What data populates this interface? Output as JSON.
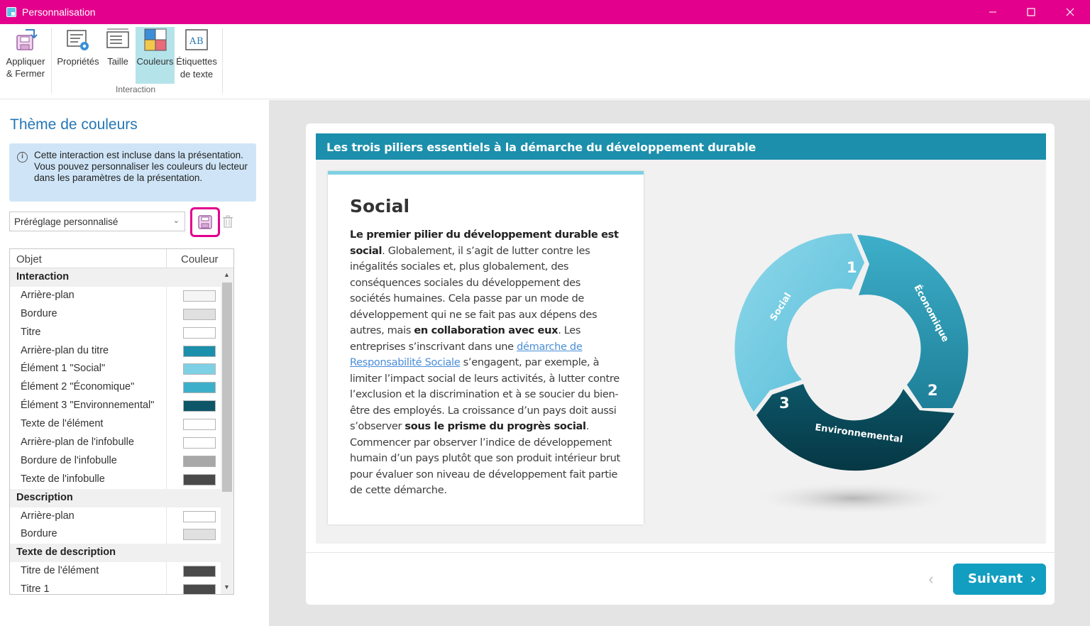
{
  "window": {
    "title": "Personnalisation",
    "controls": [
      "minimize",
      "maximize",
      "close"
    ]
  },
  "ribbon": {
    "apply_close_line1": "Appliquer",
    "apply_close_line2": "& Fermer",
    "buttons": [
      {
        "label": "Propriétés"
      },
      {
        "label": "Taille"
      },
      {
        "label": "Couleurs",
        "active": true
      },
      {
        "label_line1": "Étiquettes",
        "label_line2": "de texte"
      }
    ],
    "group_label": "Interaction"
  },
  "left_panel": {
    "title": "Thème de couleurs",
    "info_text": "Cette interaction est incluse dans la présentation. Vous pouvez personnaliser les couleurs du lecteur dans les paramètres de la présentation.",
    "preset_value": "Préréglage personnalisé",
    "table_headers": {
      "object": "Objet",
      "color": "Couleur"
    },
    "rows": [
      {
        "type": "group",
        "label": "Interaction"
      },
      {
        "type": "item",
        "label": "Arrière-plan",
        "color": "#f5f5f5"
      },
      {
        "type": "item",
        "label": "Bordure",
        "color": "#e0e0e0"
      },
      {
        "type": "item",
        "label": "Titre",
        "color": "#ffffff"
      },
      {
        "type": "item",
        "label": "Arrière-plan du titre",
        "color": "#1b8fab"
      },
      {
        "type": "item",
        "label": "Élément 1 \"Social\"",
        "color": "#7ed0e4"
      },
      {
        "type": "item",
        "label": "Élément 2 \"Économique\"",
        "color": "#3eafca"
      },
      {
        "type": "item",
        "label": "Élément 3 \"Environnemental\"",
        "color": "#0c5668"
      },
      {
        "type": "item",
        "label": "Texte de l'élément",
        "color": "#ffffff"
      },
      {
        "type": "item",
        "label": "Arrière-plan de l'infobulle",
        "color": "#ffffff"
      },
      {
        "type": "item",
        "label": "Bordure de l'infobulle",
        "color": "#a8a8a8"
      },
      {
        "type": "item",
        "label": "Texte de l'infobulle",
        "color": "#4a4a4a"
      },
      {
        "type": "group",
        "label": "Description"
      },
      {
        "type": "item",
        "label": "Arrière-plan",
        "color": "#ffffff"
      },
      {
        "type": "item",
        "label": "Bordure",
        "color": "#e0e0e0"
      },
      {
        "type": "group",
        "label": "Texte de description"
      },
      {
        "type": "item",
        "label": "Titre de l'élément",
        "color": "#4a4a4a"
      },
      {
        "type": "item",
        "label": "Titre 1",
        "color": "#4a4a4a"
      }
    ]
  },
  "slide": {
    "header": "Les trois piliers essentiels à la démarche du développement durable",
    "panel_title": "Social",
    "body": {
      "b1": "Le premier pilier du développement durable est social",
      "t1": ". Globalement, il s’agit de lutter contre les inégalités sociales et, plus globalement, des conséquences sociales du développement des sociétés humaines. Cela passe par un mode de développement qui ne se fait pas aux dépens des autres, mais ",
      "b2": "en collaboration avec eux",
      "t2": ". Les entreprises s’inscrivant dans une ",
      "link": "démarche de Responsabilité Sociale",
      "t3": " s’engagent, par exemple, à limiter l’impact social de leurs activités, à lutter contre l’exclusion et la discrimination et à se soucier du bien-être des employés. La croissance d’un pays doit aussi s’observer ",
      "b3": "sous le prisme du progrès social",
      "t4": ". Commencer par observer l’indice de développement humain d’un pays plutôt que son produit intérieur brut pour évaluer son niveau de développement fait partie de cette démarche."
    },
    "segments": [
      {
        "number": "1",
        "label": "Social",
        "color": "#7ed0e4"
      },
      {
        "number": "2",
        "label": "Économique",
        "color": "#3eafca"
      },
      {
        "number": "3",
        "label": "Environnemental",
        "color": "#0c5668"
      }
    ]
  },
  "navigation": {
    "next_label": "Suivant"
  }
}
